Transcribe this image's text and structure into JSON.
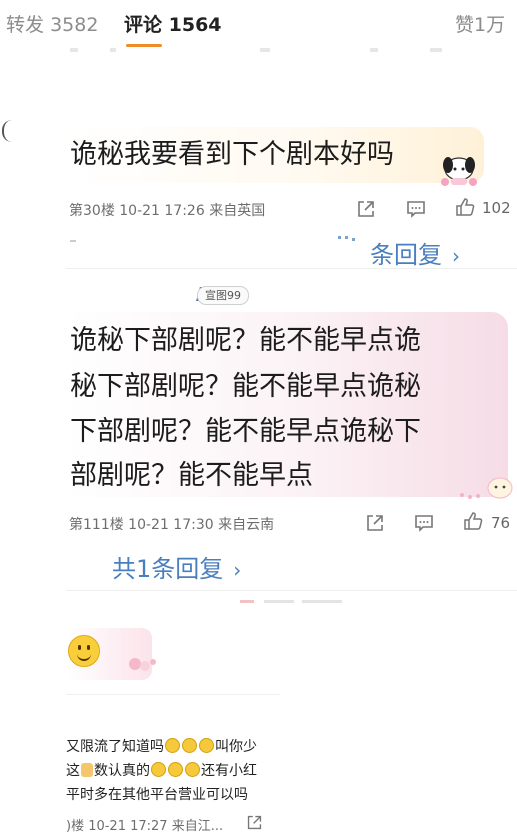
{
  "tabs": {
    "repost": {
      "label": "转发",
      "count": "3582"
    },
    "comments": {
      "label": "评论",
      "count": "1564"
    },
    "likes": {
      "label": "赞",
      "count": "1万"
    }
  },
  "accent_color": "#f08d27",
  "link_color": "#4a7fbf",
  "comments": [
    {
      "text": "诡秘我要看到下个剧本好吗",
      "meta": "第30楼 10-21 17:26 来自英国",
      "likes": "102",
      "replies": "条回复"
    },
    {
      "badge": "宣图99",
      "lines": [
        "诡秘下部剧呢？能不能早点诡",
        "秘下部剧呢？能不能早点诡秘",
        "下部剧呢？能不能早点诡秘下",
        "部剧呢？能不能早点"
      ],
      "meta": "第111楼 10-21 17:30 来自云南",
      "likes": "76",
      "replies": "共1条回复"
    },
    {
      "lines": [
        "又限流了知道吗",
        "叫你少",
        "这",
        "数认真的",
        "还有小红",
        "平时多在其他平台营业可以吗"
      ],
      "meta": ")楼 10-21 17:27 来自江..."
    }
  ],
  "icons": [
    "share-icon",
    "comment-icon",
    "like-icon",
    "chevron-right-icon",
    "smiley-icon"
  ]
}
